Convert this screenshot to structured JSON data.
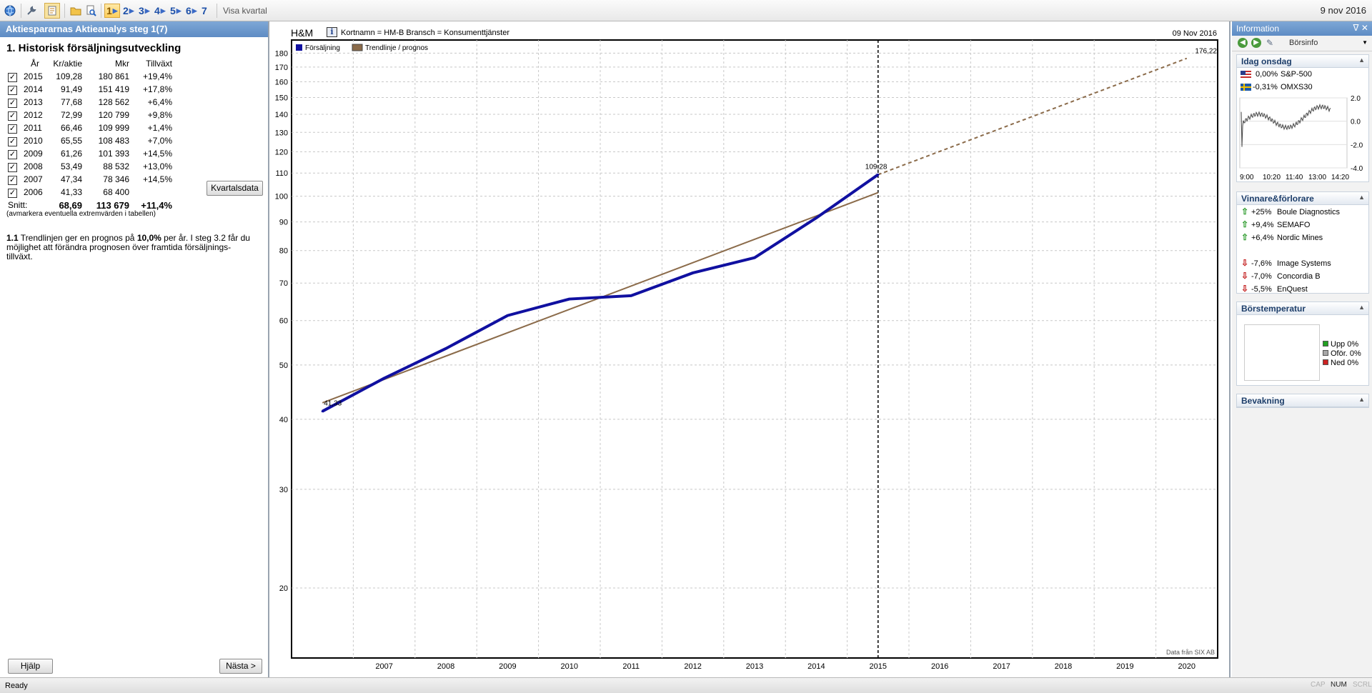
{
  "toolbar": {
    "steps": [
      "1",
      "2",
      "3",
      "4",
      "5",
      "6",
      "7"
    ],
    "visa_kvartal": "Visa kvartal",
    "date": "9 nov 2016"
  },
  "left": {
    "header": "Aktiespararnas Aktieanalys steg 1(7)",
    "section_title": "1. Historisk försäljningsutveckling",
    "columns": [
      "År",
      "Kr/aktie",
      "Mkr",
      "Tillväxt"
    ],
    "rows": [
      {
        "year": "2015",
        "kr": "109,28",
        "mkr": "180 861",
        "growth": "+19,4%"
      },
      {
        "year": "2014",
        "kr": "91,49",
        "mkr": "151 419",
        "growth": "+17,8%"
      },
      {
        "year": "2013",
        "kr": "77,68",
        "mkr": "128 562",
        "growth": "+6,4%"
      },
      {
        "year": "2012",
        "kr": "72,99",
        "mkr": "120 799",
        "growth": "+9,8%"
      },
      {
        "year": "2011",
        "kr": "66,46",
        "mkr": "109 999",
        "growth": "+1,4%"
      },
      {
        "year": "2010",
        "kr": "65,55",
        "mkr": "108 483",
        "growth": "+7,0%"
      },
      {
        "year": "2009",
        "kr": "61,26",
        "mkr": "101 393",
        "growth": "+14,5%"
      },
      {
        "year": "2008",
        "kr": "53,49",
        "mkr": "88 532",
        "growth": "+13,0%"
      },
      {
        "year": "2007",
        "kr": "47,34",
        "mkr": "78 346",
        "growth": "+14,5%"
      },
      {
        "year": "2006",
        "kr": "41,33",
        "mkr": "68 400",
        "growth": ""
      }
    ],
    "avg": {
      "label": "Snitt:",
      "kr": "68,69",
      "mkr": "113 679",
      "growth": "+11,4%"
    },
    "avmarkera": "(avmarkera eventuella extremvärden i tabellen)",
    "kvartalsdata_button": "Kvartalsdata",
    "note_num": "1.1",
    "note_part1": " Trendlinjen ger en prognos på ",
    "note_pct": "10,0%",
    "note_part2": " per år.  I steg 3.2 får du möjlighet att förändra prognosen över framtida försäljnings-tillväxt.",
    "help_button": "Hjälp",
    "next_button": "Nästa >"
  },
  "chart": {
    "title": "H&M",
    "meta": "Kortnamn = HM-B   Bransch = Konsumenttjänster",
    "date": "09 Nov 2016",
    "source": "Data från SIX AB",
    "label_start": "41,33",
    "label_last": "109,28",
    "label_end": "176,22"
  },
  "chart_data": {
    "type": "line",
    "yscale": "log",
    "ylim": [
      15,
      190
    ],
    "yticks": [
      20,
      30,
      40,
      50,
      60,
      70,
      80,
      90,
      100,
      110,
      120,
      130,
      140,
      150,
      160,
      170,
      180
    ],
    "x": [
      "2007",
      "2008",
      "2009",
      "2010",
      "2011",
      "2012",
      "2013",
      "2014",
      "2015",
      "2016",
      "2017",
      "2018",
      "2019",
      "2020"
    ],
    "legend_position": "top-left",
    "grid": true,
    "series": [
      {
        "name": "Försäljning",
        "color": "#1010a0",
        "x": [
          2006,
          2007,
          2008,
          2009,
          2010,
          2011,
          2012,
          2013,
          2014,
          2015
        ],
        "values": [
          41.33,
          47.34,
          53.49,
          61.26,
          65.55,
          66.46,
          72.99,
          77.68,
          91.49,
          109.28
        ]
      },
      {
        "name": "Trendlinje / prognos",
        "color": "#8b6b4a",
        "x": [
          2006,
          2015
        ],
        "values": [
          42.8,
          101.5
        ]
      },
      {
        "name": "",
        "color": "#8b6b4a",
        "dashed": true,
        "x": [
          2015,
          2020
        ],
        "values": [
          109.28,
          176.22
        ]
      }
    ],
    "divider_x": 2015
  },
  "right": {
    "header": "Information",
    "borsinfo": "Börsinfo",
    "today": {
      "title": "Idag onsdag",
      "indices": [
        {
          "change": "0,00%",
          "name": "S&P-500"
        },
        {
          "change": "-0,31%",
          "name": "OMXS30"
        }
      ],
      "spark_yticks": [
        "2.0",
        "0.0",
        "-2.0",
        "-4.0"
      ],
      "spark_xticks": [
        "9:00",
        "10:20",
        "11:40",
        "13:00",
        "14:20"
      ]
    },
    "winners": {
      "title": "Vinnare&förlorare",
      "up": [
        {
          "change": "+25%",
          "name": "Boule Diagnostics"
        },
        {
          "change": "+9,4%",
          "name": "SEMAFO"
        },
        {
          "change": "+6,4%",
          "name": "Nordic Mines"
        }
      ],
      "down": [
        {
          "change": "-7,6%",
          "name": "Image Systems"
        },
        {
          "change": "-7,0%",
          "name": "Concordia B"
        },
        {
          "change": "-5,5%",
          "name": "EnQuest"
        }
      ]
    },
    "temp": {
      "title": "Börstemperatur",
      "legend": [
        {
          "label": "Upp 0%",
          "color": "#22a022"
        },
        {
          "label": "Oför. 0%",
          "color": "#a8a8a8"
        },
        {
          "label": "Ned 0%",
          "color": "#cc2222"
        }
      ]
    },
    "bevakning": "Bevakning"
  },
  "status": {
    "text": "Ready",
    "indicators": [
      "CAP",
      "NUM",
      "SCRL"
    ]
  }
}
